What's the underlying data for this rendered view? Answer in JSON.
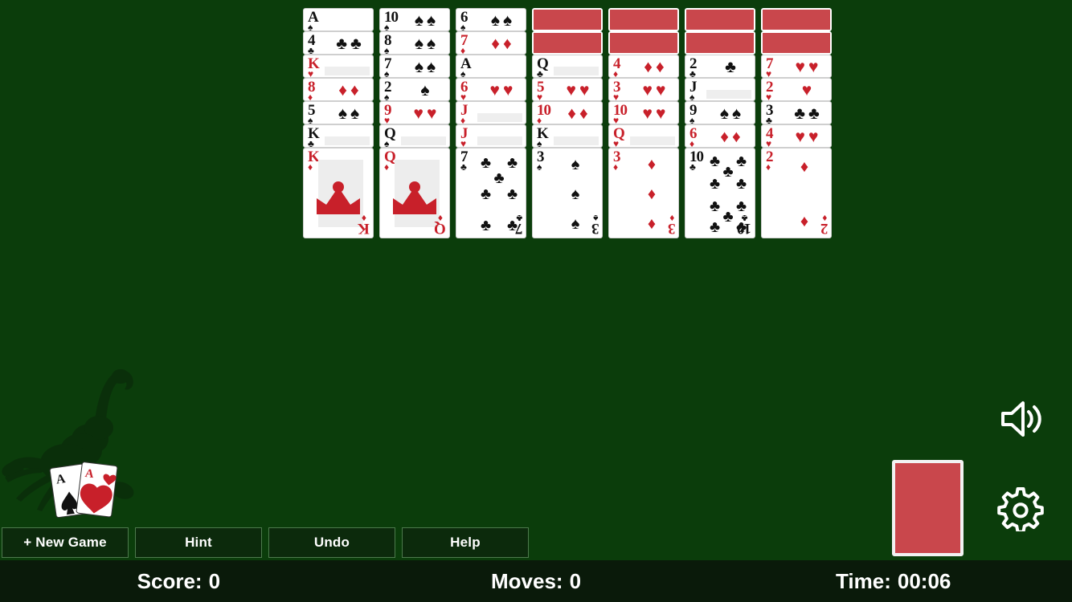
{
  "theme": {
    "table_green": "#0b3d0b",
    "status_bar_bg": "#0a1a0a",
    "card_back_red": "#c9474c",
    "red_suit": "#c8202a",
    "black_suit": "#111111",
    "button_bg": "#0c2a0c",
    "button_border": "#4d7a4d"
  },
  "game": {
    "name": "Scorpion Solitaire"
  },
  "tableau": {
    "columns": [
      {
        "index": 1,
        "facedown_count": 0,
        "cards": [
          {
            "rank": "A",
            "suit": "spades",
            "color": "black",
            "facedown": false
          },
          {
            "rank": "4",
            "suit": "clubs",
            "color": "black",
            "facedown": false
          },
          {
            "rank": "K",
            "suit": "hearts",
            "color": "red",
            "facedown": false
          },
          {
            "rank": "8",
            "suit": "diamonds",
            "color": "red",
            "facedown": false
          },
          {
            "rank": "5",
            "suit": "spades",
            "color": "black",
            "facedown": false
          },
          {
            "rank": "K",
            "suit": "clubs",
            "color": "black",
            "facedown": false
          },
          {
            "rank": "K",
            "suit": "diamonds",
            "color": "red",
            "facedown": false
          }
        ]
      },
      {
        "index": 2,
        "facedown_count": 0,
        "cards": [
          {
            "rank": "10",
            "suit": "spades",
            "color": "black",
            "facedown": false
          },
          {
            "rank": "8",
            "suit": "spades",
            "color": "black",
            "facedown": false
          },
          {
            "rank": "7",
            "suit": "spades",
            "color": "black",
            "facedown": false
          },
          {
            "rank": "2",
            "suit": "spades",
            "color": "black",
            "facedown": false
          },
          {
            "rank": "9",
            "suit": "hearts",
            "color": "red",
            "facedown": false
          },
          {
            "rank": "Q",
            "suit": "spades",
            "color": "black",
            "facedown": false
          },
          {
            "rank": "Q",
            "suit": "diamonds",
            "color": "red",
            "facedown": false
          }
        ]
      },
      {
        "index": 3,
        "facedown_count": 0,
        "cards": [
          {
            "rank": "6",
            "suit": "spades",
            "color": "black",
            "facedown": false
          },
          {
            "rank": "7",
            "suit": "diamonds",
            "color": "red",
            "facedown": false
          },
          {
            "rank": "A",
            "suit": "spades",
            "color": "black",
            "facedown": false
          },
          {
            "rank": "6",
            "suit": "hearts",
            "color": "red",
            "facedown": false
          },
          {
            "rank": "J",
            "suit": "diamonds",
            "color": "red",
            "facedown": false
          },
          {
            "rank": "J",
            "suit": "hearts",
            "color": "red",
            "facedown": false
          },
          {
            "rank": "7",
            "suit": "clubs",
            "color": "black",
            "facedown": false
          }
        ]
      },
      {
        "index": 4,
        "facedown_count": 2,
        "cards": [
          {
            "rank": "",
            "suit": "",
            "color": "back",
            "facedown": true
          },
          {
            "rank": "",
            "suit": "",
            "color": "back",
            "facedown": true
          },
          {
            "rank": "Q",
            "suit": "clubs",
            "color": "black",
            "facedown": false
          },
          {
            "rank": "5",
            "suit": "hearts",
            "color": "red",
            "facedown": false
          },
          {
            "rank": "10",
            "suit": "diamonds",
            "color": "red",
            "facedown": false
          },
          {
            "rank": "K",
            "suit": "spades",
            "color": "black",
            "facedown": false
          },
          {
            "rank": "3",
            "suit": "spades",
            "color": "black",
            "facedown": false
          }
        ]
      },
      {
        "index": 5,
        "facedown_count": 2,
        "cards": [
          {
            "rank": "",
            "suit": "",
            "color": "back",
            "facedown": true
          },
          {
            "rank": "",
            "suit": "",
            "color": "back",
            "facedown": true
          },
          {
            "rank": "4",
            "suit": "diamonds",
            "color": "red",
            "facedown": false
          },
          {
            "rank": "3",
            "suit": "hearts",
            "color": "red",
            "facedown": false
          },
          {
            "rank": "10",
            "suit": "hearts",
            "color": "red",
            "facedown": false
          },
          {
            "rank": "Q",
            "suit": "hearts",
            "color": "red",
            "facedown": false
          },
          {
            "rank": "3",
            "suit": "diamonds",
            "color": "red",
            "facedown": false
          }
        ]
      },
      {
        "index": 6,
        "facedown_count": 2,
        "cards": [
          {
            "rank": "",
            "suit": "",
            "color": "back",
            "facedown": true
          },
          {
            "rank": "",
            "suit": "",
            "color": "back",
            "facedown": true
          },
          {
            "rank": "2",
            "suit": "clubs",
            "color": "black",
            "facedown": false
          },
          {
            "rank": "J",
            "suit": "spades",
            "color": "black",
            "facedown": false
          },
          {
            "rank": "9",
            "suit": "spades",
            "color": "black",
            "facedown": false
          },
          {
            "rank": "6",
            "suit": "diamonds",
            "color": "red",
            "facedown": false
          },
          {
            "rank": "10",
            "suit": "clubs",
            "color": "black",
            "facedown": false
          }
        ]
      },
      {
        "index": 7,
        "facedown_count": 2,
        "cards": [
          {
            "rank": "",
            "suit": "",
            "color": "back",
            "facedown": true
          },
          {
            "rank": "",
            "suit": "",
            "color": "back",
            "facedown": true
          },
          {
            "rank": "7",
            "suit": "hearts",
            "color": "red",
            "facedown": false
          },
          {
            "rank": "2",
            "suit": "hearts",
            "color": "red",
            "facedown": false
          },
          {
            "rank": "3",
            "suit": "clubs",
            "color": "black",
            "facedown": false
          },
          {
            "rank": "4",
            "suit": "hearts",
            "color": "red",
            "facedown": false
          },
          {
            "rank": "2",
            "suit": "diamonds",
            "color": "red",
            "facedown": false
          }
        ]
      }
    ]
  },
  "stock": {
    "label": "stock-pile",
    "cards_remaining": 3,
    "face": "back"
  },
  "toolbar": {
    "new_game_label": "+ New Game",
    "hint_label": "Hint",
    "undo_label": "Undo",
    "help_label": "Help"
  },
  "status": {
    "score_label": "Score:",
    "score_value": "0",
    "moves_label": "Moves:",
    "moves_value": "0",
    "time_label": "Time:",
    "time_value": "00:06"
  },
  "controls": {
    "sound_icon": "speaker-on-icon",
    "settings_icon": "gear-icon"
  },
  "logo": {
    "ace_left_rank": "A",
    "ace_left_suit": "spades",
    "ace_right_rank": "A",
    "ace_right_suit": "hearts"
  }
}
